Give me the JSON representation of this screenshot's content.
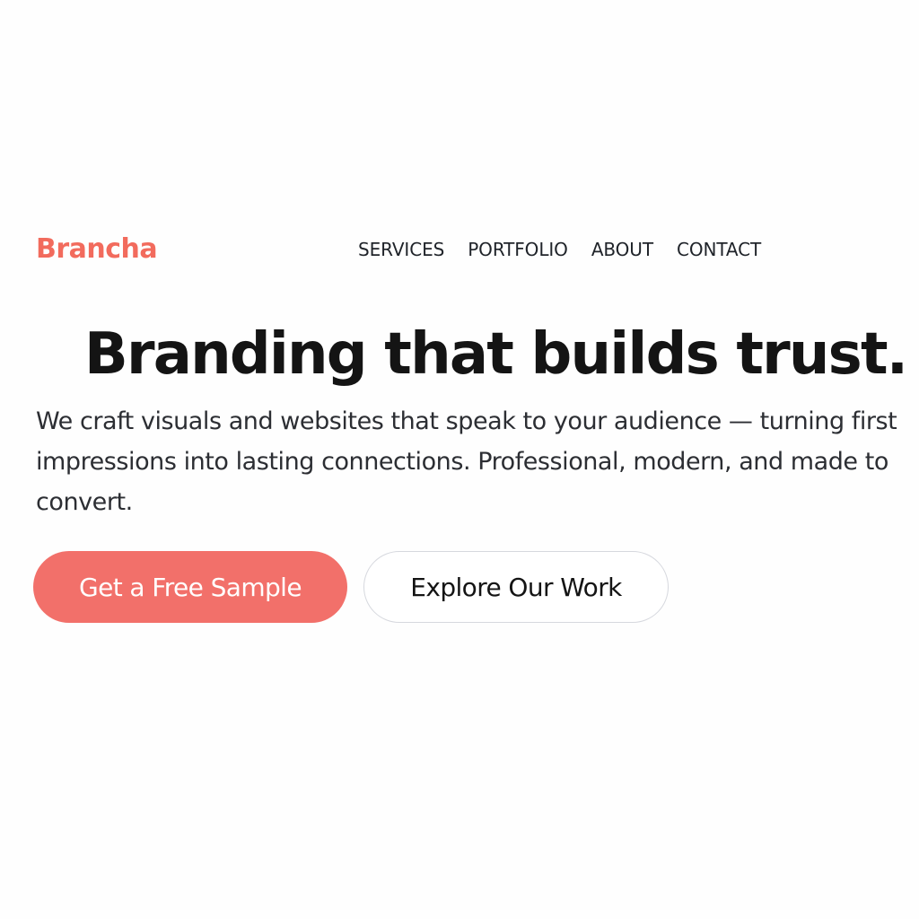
{
  "header": {
    "logo": "Brancha",
    "nav": [
      {
        "label": "SERVICES"
      },
      {
        "label": "PORTFOLIO"
      },
      {
        "label": "ABOUT"
      },
      {
        "label": "CONTACT"
      }
    ]
  },
  "hero": {
    "title": "Branding that builds trust.",
    "description": "We craft visuals and websites that speak to your audience — turning first impressions into lasting connections. Professional, modern, and made to convert.",
    "primary_button": "Get a Free Sample",
    "secondary_button": "Explore Our Work"
  },
  "colors": {
    "accent": "#f2706a",
    "text": "#141414",
    "background": "#fefefe"
  }
}
